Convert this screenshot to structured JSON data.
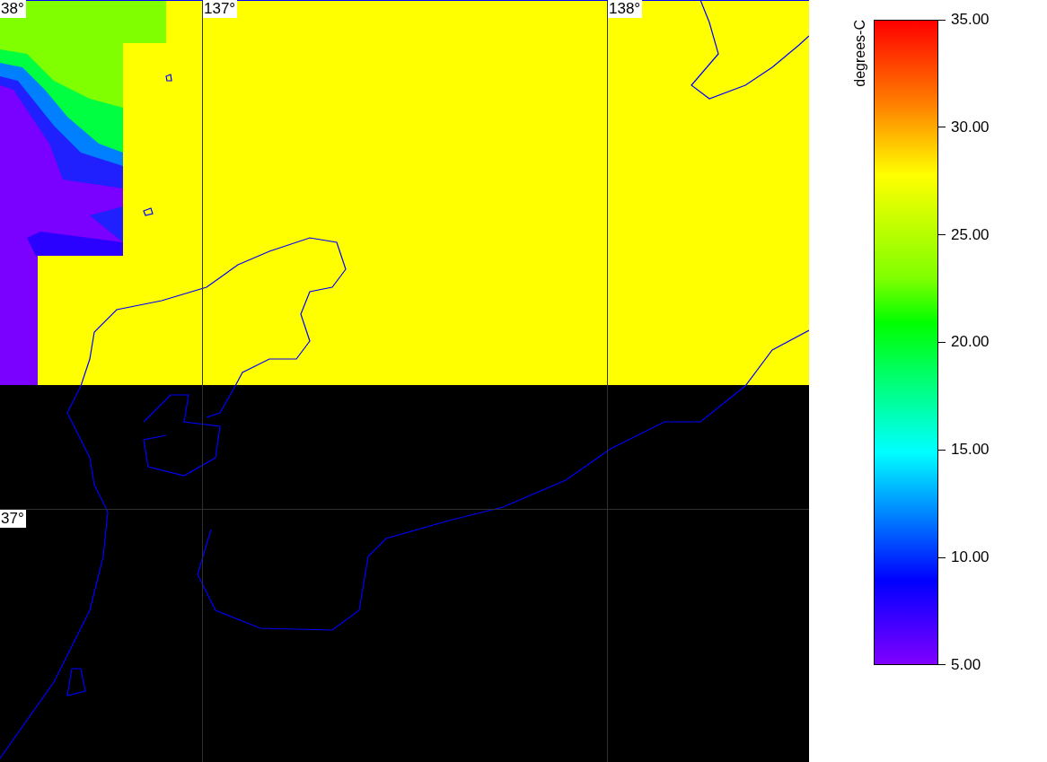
{
  "map": {
    "longitude_labels": [
      "137°",
      "138°"
    ],
    "latitude_labels": [
      "38°",
      "37°"
    ]
  },
  "legend": {
    "unit": "degrees-C",
    "ticks": [
      "35.00",
      "30.00",
      "25.00",
      "20.00",
      "15.00",
      "10.00",
      "5.00"
    ]
  }
}
